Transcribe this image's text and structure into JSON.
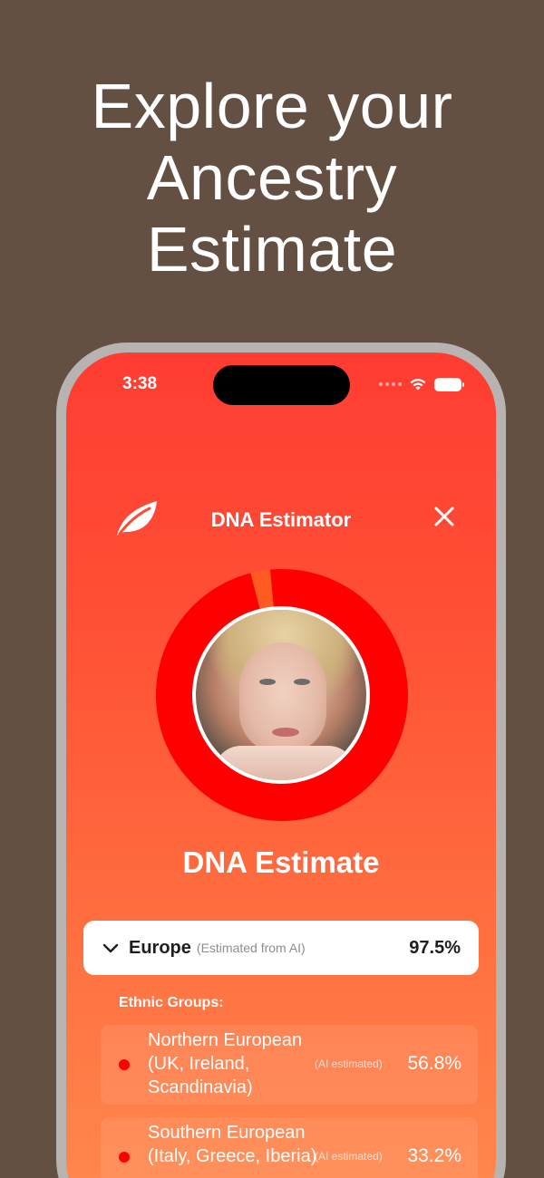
{
  "headline": {
    "line1": "Explore your",
    "line2": "Ancestry",
    "line3": "Estimate"
  },
  "status_bar": {
    "time": "3:38",
    "icons": [
      "signal-dots-icon",
      "wifi-icon",
      "battery-icon"
    ]
  },
  "header": {
    "title": "DNA Estimator",
    "left_icon": "leaf-icon",
    "right_icon": "close-icon"
  },
  "ancestry_donut": {
    "segments": [
      {
        "region": "Europe",
        "percent": 97.5,
        "color": "#ff0000"
      },
      {
        "region": "Other",
        "percent": 2.5,
        "color": "#ff5a1f"
      }
    ]
  },
  "section": {
    "title": "DNA Estimate"
  },
  "region": {
    "name": "Europe",
    "note": "(Estimated from AI)",
    "percent": "97.5%"
  },
  "ethnic_groups": {
    "label": "Ethnic Groups:",
    "items": [
      {
        "name": "Northern European (UK, Ireland, Scandinavia)",
        "note": "(AI estimated)",
        "percent": "56.8%",
        "color": "#ff0000"
      },
      {
        "name": "Southern European (Italy, Greece, Iberia)",
        "note": "(AI estimated)",
        "percent": "33.2%",
        "color": "#ff0000"
      }
    ]
  },
  "colors": {
    "background": "#644f43",
    "screen_top": "#ff3c32",
    "screen_bottom": "#ff8a4e",
    "accent_red": "#ff0000"
  }
}
